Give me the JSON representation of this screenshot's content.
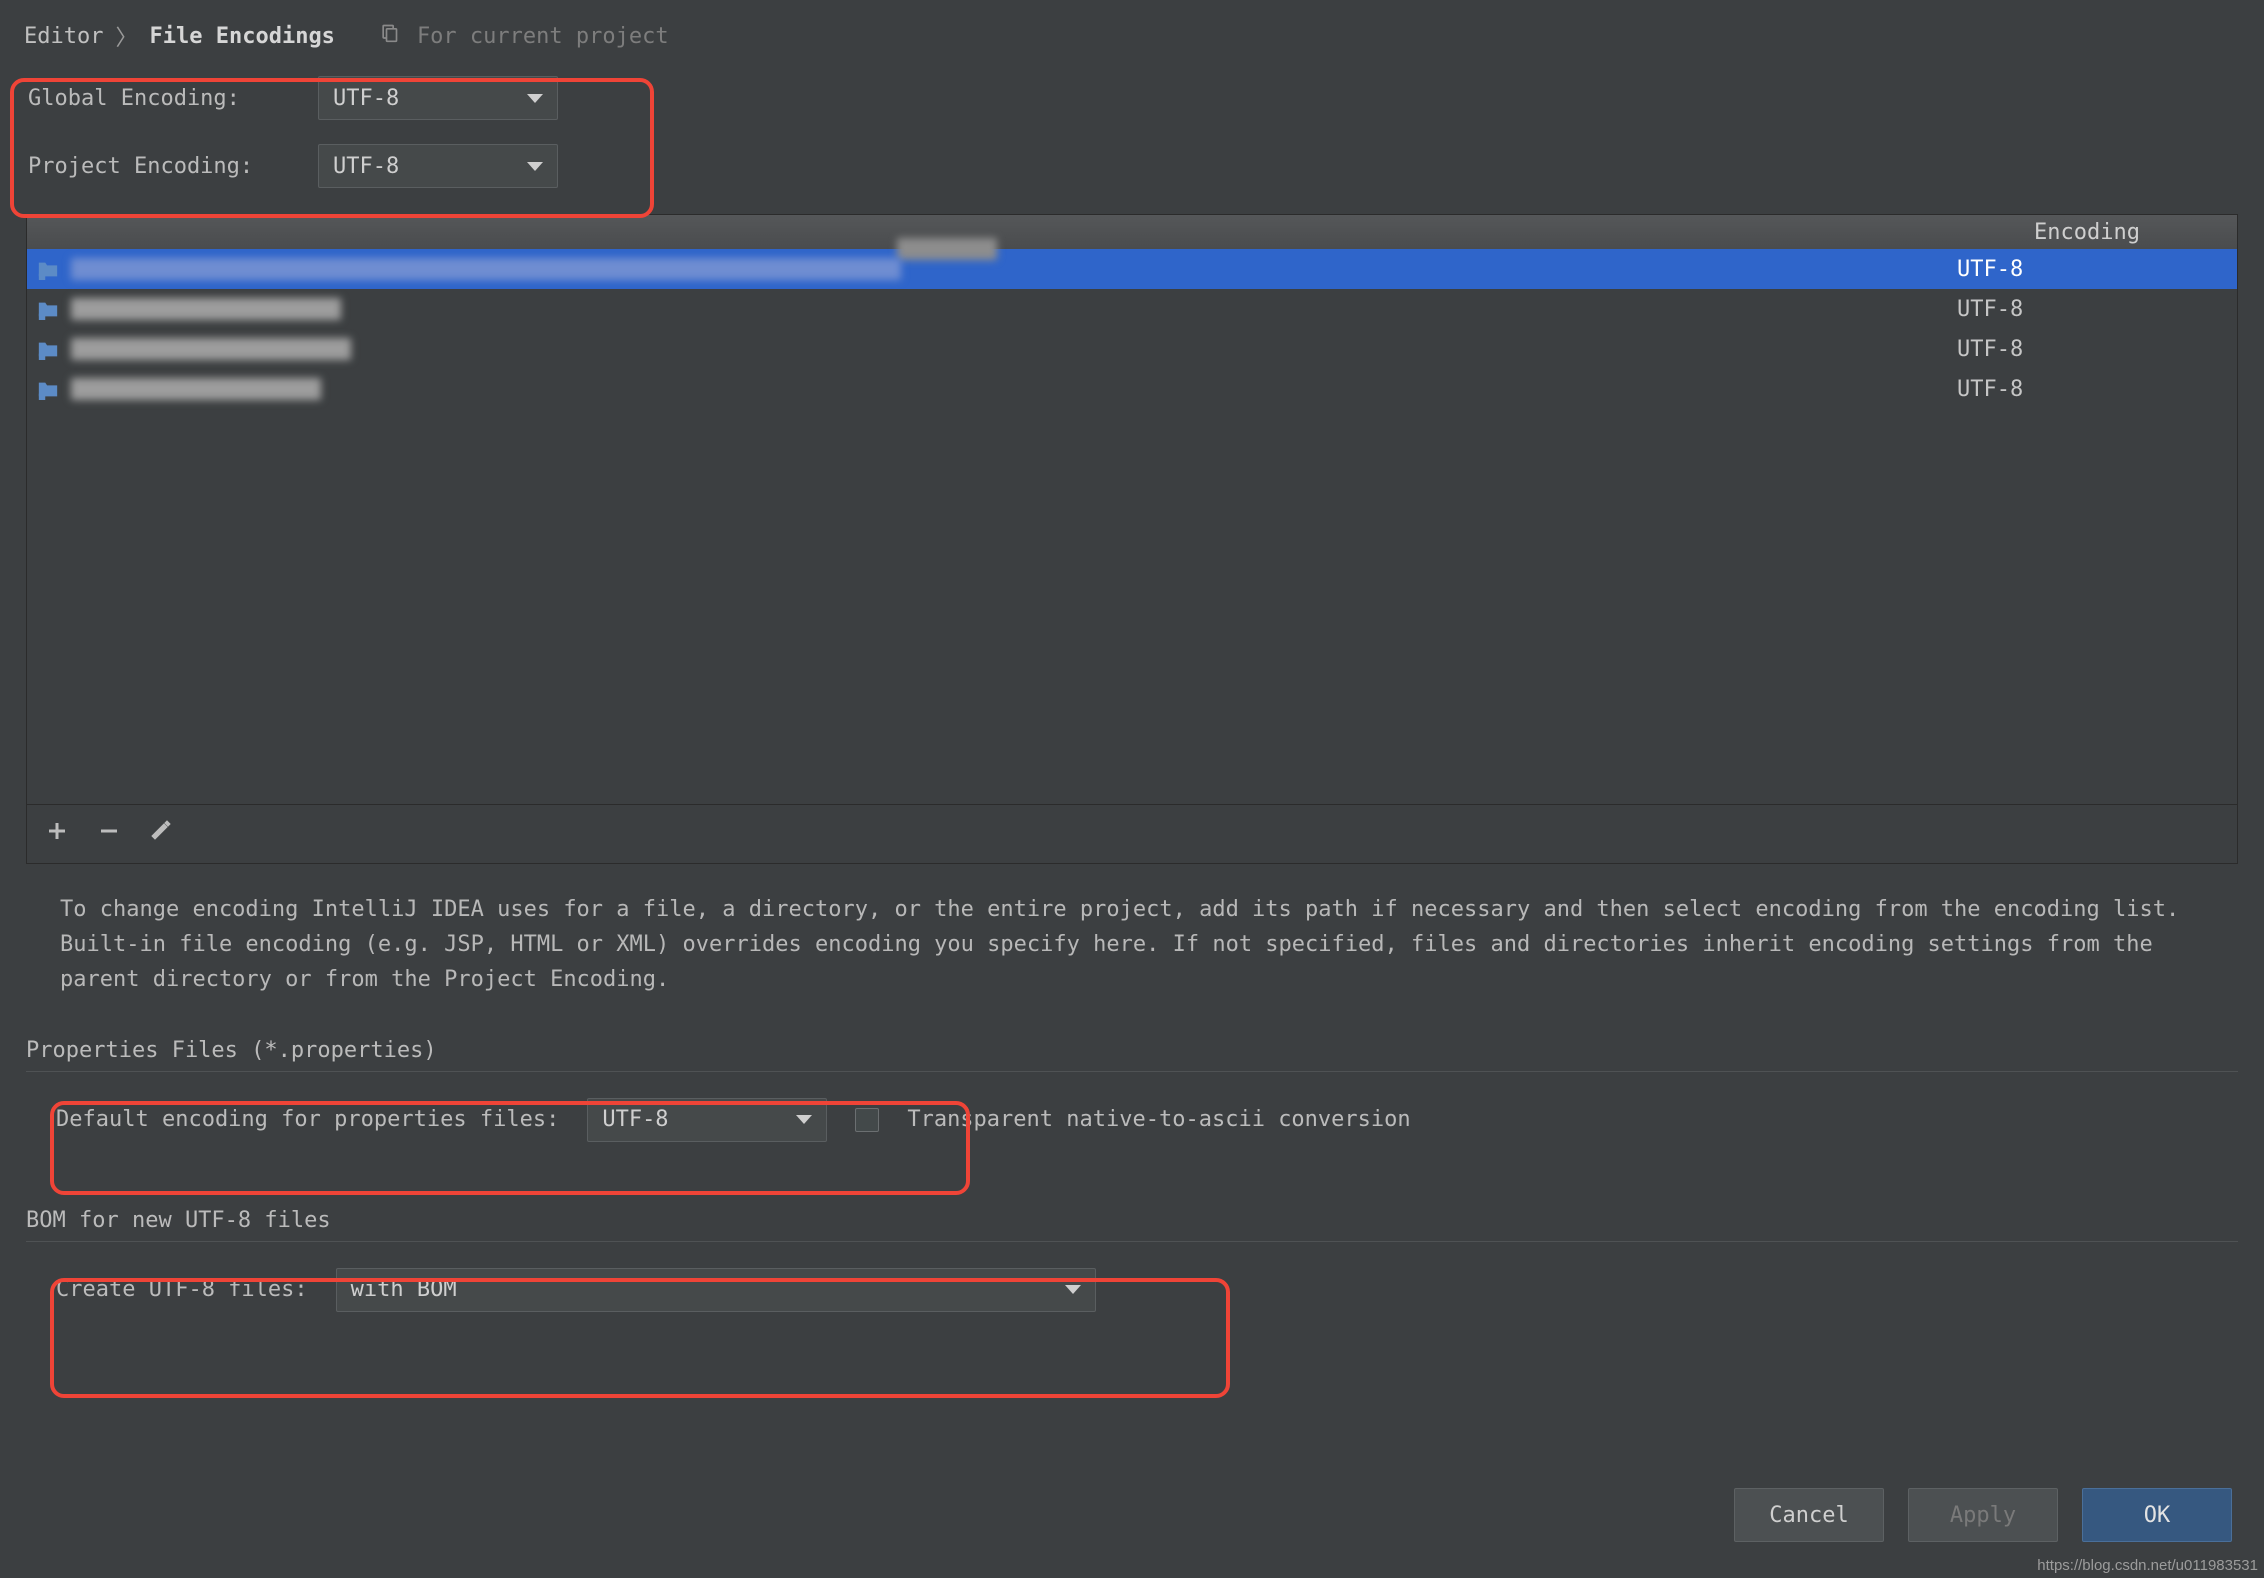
{
  "breadcrumb": {
    "root": "Editor",
    "sep": "〉",
    "leaf": "File Encodings",
    "scope": "For current project"
  },
  "globalEncoding": {
    "label": "Global Encoding:",
    "value": "UTF-8"
  },
  "projectEncoding": {
    "label": "Project Encoding:",
    "value": "UTF-8"
  },
  "table": {
    "encHeader": "Encoding",
    "rows": [
      {
        "encoding": "UTF-8",
        "selected": true,
        "pathBlurWidth": 830
      },
      {
        "encoding": "UTF-8",
        "selected": false,
        "pathBlurWidth": 270
      },
      {
        "encoding": "UTF-8",
        "selected": false,
        "pathBlurWidth": 280
      },
      {
        "encoding": "UTF-8",
        "selected": false,
        "pathBlurWidth": 250
      }
    ]
  },
  "info": "To change encoding IntelliJ IDEA uses for a file, a directory, or the entire project, add its path if necessary and then select encoding from the encoding list. Built-in file encoding (e.g. JSP, HTML or XML) overrides encoding you specify here. If not specified, files and directories inherit encoding settings from the parent directory or from the Project Encoding.",
  "properties": {
    "sectionTitle": "Properties Files (*.properties)",
    "label": "Default encoding for properties files:",
    "value": "UTF-8",
    "checkboxLabel": "Transparent native-to-ascii conversion"
  },
  "bom": {
    "sectionTitle": "BOM for new UTF-8 files",
    "label": "Create UTF-8 files:",
    "value": "with BOM"
  },
  "buttons": {
    "cancel": "Cancel",
    "apply": "Apply",
    "ok": "OK"
  },
  "watermark": "https://blog.csdn.net/u011983531"
}
